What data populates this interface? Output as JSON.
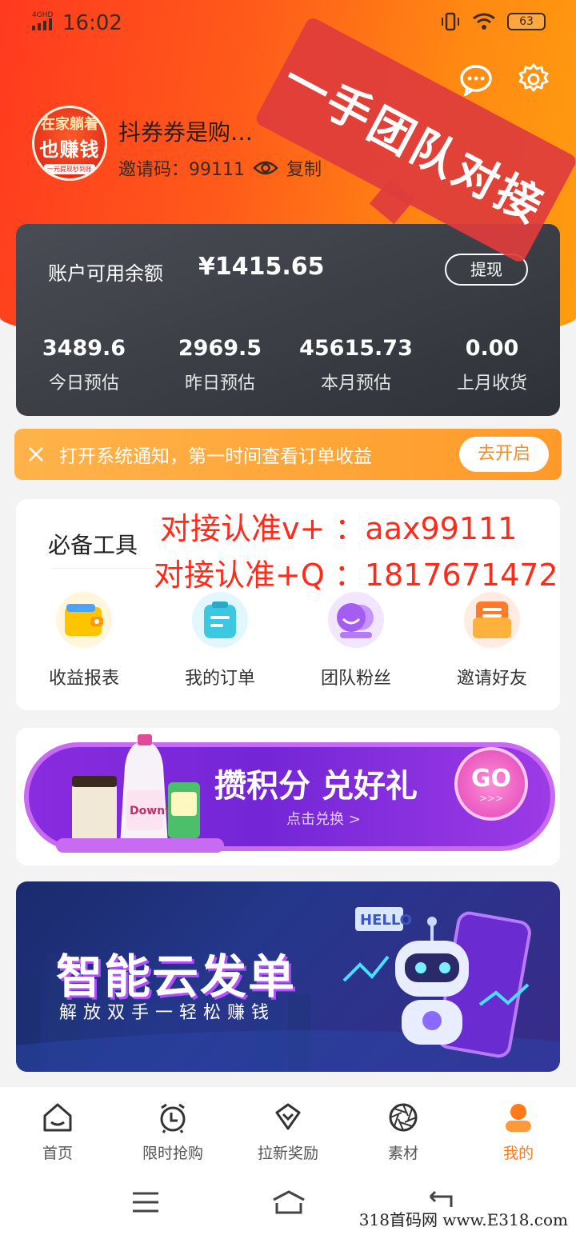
{
  "status_bar": {
    "network": "4GHD",
    "time": "16:02",
    "battery": "63"
  },
  "header": {
    "avatar": {
      "line1": "在家躺着",
      "line2": "也赚钱",
      "line3": "一元提现秒到账"
    },
    "user_name": "抖券券是购…",
    "invite_label": "邀请码：99111",
    "copy_label": "复制"
  },
  "stamp": {
    "text": "一手团队对接"
  },
  "balance": {
    "label": "账户可用余额",
    "value": "¥1415.65",
    "withdraw_label": "提现",
    "stats": [
      {
        "value": "3489.6",
        "label": "今日预估"
      },
      {
        "value": "2969.5",
        "label": "昨日预估"
      },
      {
        "value": "45615.73",
        "label": "本月预估"
      },
      {
        "value": "0.00",
        "label": "上月收货"
      }
    ]
  },
  "notification": {
    "text": "打开系统通知，第一时间查看订单收益",
    "button": "去开启"
  },
  "tools": {
    "title": "必备工具",
    "items": [
      {
        "label": "收益报表",
        "icon": "wallet-icon",
        "color": "#ffc400"
      },
      {
        "label": "我的订单",
        "icon": "order-icon",
        "color": "#3cc8e0"
      },
      {
        "label": "团队粉丝",
        "icon": "team-icon",
        "color": "#a55cf0"
      },
      {
        "label": "邀请好友",
        "icon": "invite-icon",
        "color": "#ff7a2a"
      }
    ]
  },
  "overlay_text": {
    "line1": "对接认准v+ ：aax99111",
    "line2": "对接认准+Q ：1817671472"
  },
  "points_banner": {
    "title": "攒积分 兑好礼",
    "subtitle": "点击兑换 >",
    "go": "GO",
    "go_sub": ">>>",
    "brand": "Downy"
  },
  "cloud_banner": {
    "title": "智能云发单",
    "subtitle": "解放双手一轻松赚钱",
    "robot_text": "HELLO"
  },
  "bottom_nav": [
    {
      "label": "首页",
      "icon": "home-icon"
    },
    {
      "label": "限时抢购",
      "icon": "clock-icon"
    },
    {
      "label": "拉新奖励",
      "icon": "diamond-icon"
    },
    {
      "label": "素材",
      "icon": "aperture-icon"
    },
    {
      "label": "我的",
      "icon": "profile-icon",
      "active": true
    }
  ],
  "watermark": "318首码网 www.E318.com",
  "colors": {
    "accent": "#ff7a1a",
    "header_start": "#ff3a1f",
    "header_end": "#ff9d10",
    "overlay_red": "#ff2a1a"
  }
}
